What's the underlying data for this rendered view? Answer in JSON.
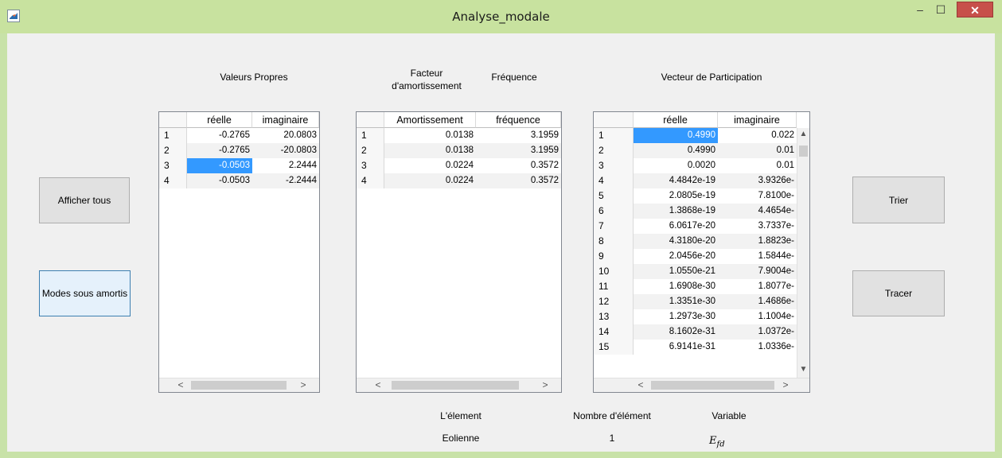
{
  "window": {
    "title": "Analyse_modale",
    "minimize_glyph": "–",
    "maximize_glyph": "☐",
    "close_glyph": "✕",
    "icon": "matlab-icon"
  },
  "headings": {
    "valeurs_propres": "Valeurs Propres",
    "facteur_amortissement": [
      "Facteur",
      "d'amortissement"
    ],
    "frequence": "Fréquence",
    "vecteur_participation": "Vecteur de Participation"
  },
  "buttons": {
    "afficher_tous": "Afficher tous",
    "modes_sous_amortis": "Modes sous amortis",
    "trier": "Trier",
    "tracer": "Tracer"
  },
  "table_eigen": {
    "columns": [
      "réelle",
      "imaginaire"
    ],
    "rows": [
      {
        "n": "1",
        "re": "-0.2765",
        "im": "20.0803"
      },
      {
        "n": "2",
        "re": "-0.2765",
        "im": "-20.0803"
      },
      {
        "n": "3",
        "re": "-0.0503",
        "im": "2.2444",
        "selected_col": "re"
      },
      {
        "n": "4",
        "re": "-0.0503",
        "im": "-2.2444"
      }
    ]
  },
  "table_damping": {
    "columns": [
      "Amortissement",
      "fréquence"
    ],
    "rows": [
      {
        "n": "1",
        "a": "0.0138",
        "f": "3.1959"
      },
      {
        "n": "2",
        "a": "0.0138",
        "f": "3.1959"
      },
      {
        "n": "3",
        "a": "0.0224",
        "f": "0.3572"
      },
      {
        "n": "4",
        "a": "0.0224",
        "f": "0.3572"
      }
    ]
  },
  "table_participation": {
    "columns": [
      "réelle",
      "imaginaire"
    ],
    "rows": [
      {
        "n": "1",
        "re": "0.4990",
        "im": "0.022",
        "selected_col": "re"
      },
      {
        "n": "2",
        "re": "0.4990",
        "im": "0.01"
      },
      {
        "n": "3",
        "re": "0.0020",
        "im": "0.01"
      },
      {
        "n": "4",
        "re": "4.4842e-19",
        "im": "3.9326e-"
      },
      {
        "n": "5",
        "re": "2.0805e-19",
        "im": "7.8100e-"
      },
      {
        "n": "6",
        "re": "1.3868e-19",
        "im": "4.4654e-"
      },
      {
        "n": "7",
        "re": "6.0617e-20",
        "im": "3.7337e-"
      },
      {
        "n": "8",
        "re": "4.3180e-20",
        "im": "1.8823e-"
      },
      {
        "n": "9",
        "re": "2.0456e-20",
        "im": "1.5844e-"
      },
      {
        "n": "10",
        "re": "1.0550e-21",
        "im": "7.9004e-"
      },
      {
        "n": "11",
        "re": "1.6908e-30",
        "im": "1.8077e-"
      },
      {
        "n": "12",
        "re": "1.3351e-30",
        "im": "1.4686e-"
      },
      {
        "n": "13",
        "re": "1.2973e-30",
        "im": "1.1004e-"
      },
      {
        "n": "14",
        "re": "8.1602e-31",
        "im": "1.0372e-"
      },
      {
        "n": "15",
        "re": "6.9141e-31",
        "im": "1.0336e-"
      }
    ]
  },
  "footer": {
    "element_label": "L'élement",
    "element_value": "Eolienne",
    "nombre_label": "Nombre d'élément",
    "nombre_value": "1",
    "variable_label": "Variable",
    "variable_value_main": "E",
    "variable_value_sub": "fd"
  }
}
